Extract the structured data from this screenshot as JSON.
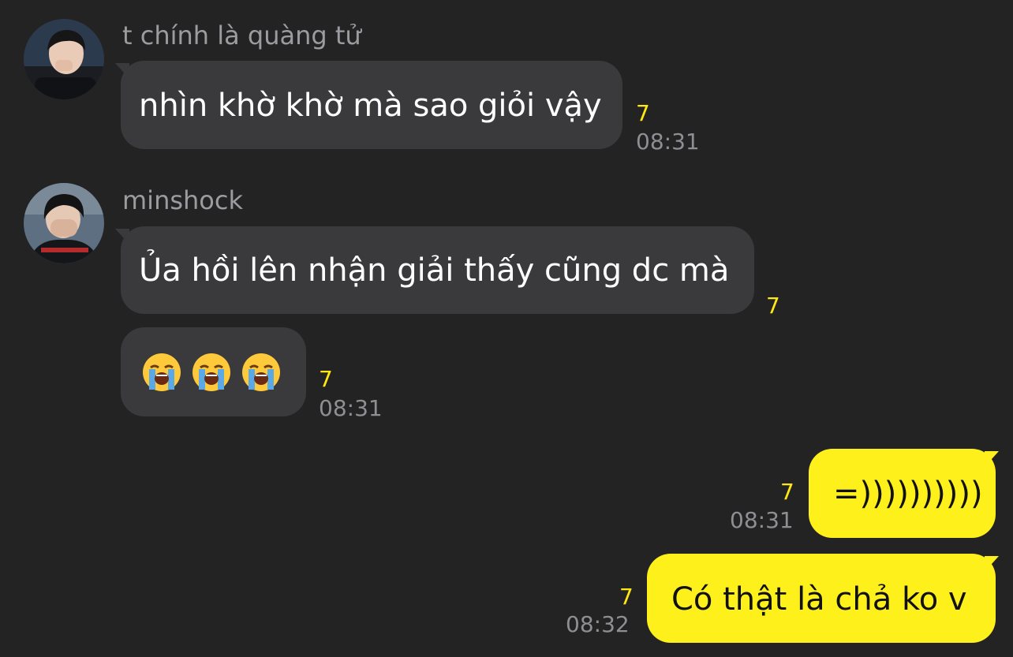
{
  "messages": [
    {
      "sender": "t chính là quàng tử",
      "text": "nhìn khờ khờ mà sao giỏi vậy",
      "unread": "7",
      "time": "08:31",
      "direction": "incoming"
    },
    {
      "sender": "minshock",
      "text": "Ủa hồi lên nhận giải thấy cũng dc mà",
      "unread": "7",
      "direction": "incoming"
    },
    {
      "emojis": [
        "loudly-crying-face",
        "loudly-crying-face",
        "loudly-crying-face"
      ],
      "unread": "7",
      "time": "08:31",
      "direction": "incoming"
    },
    {
      "text": "=))))))))))",
      "unread": "7",
      "time": "08:31",
      "direction": "outgoing"
    },
    {
      "text": "Có thật là chả ko v",
      "unread": "7",
      "time": "08:32",
      "direction": "outgoing"
    }
  ],
  "colors": {
    "background": "#232324",
    "incoming_bubble": "#3a3a3c",
    "outgoing_bubble": "#fef01b",
    "unread_count": "#ffe812",
    "meta_text": "#8e8e93"
  }
}
